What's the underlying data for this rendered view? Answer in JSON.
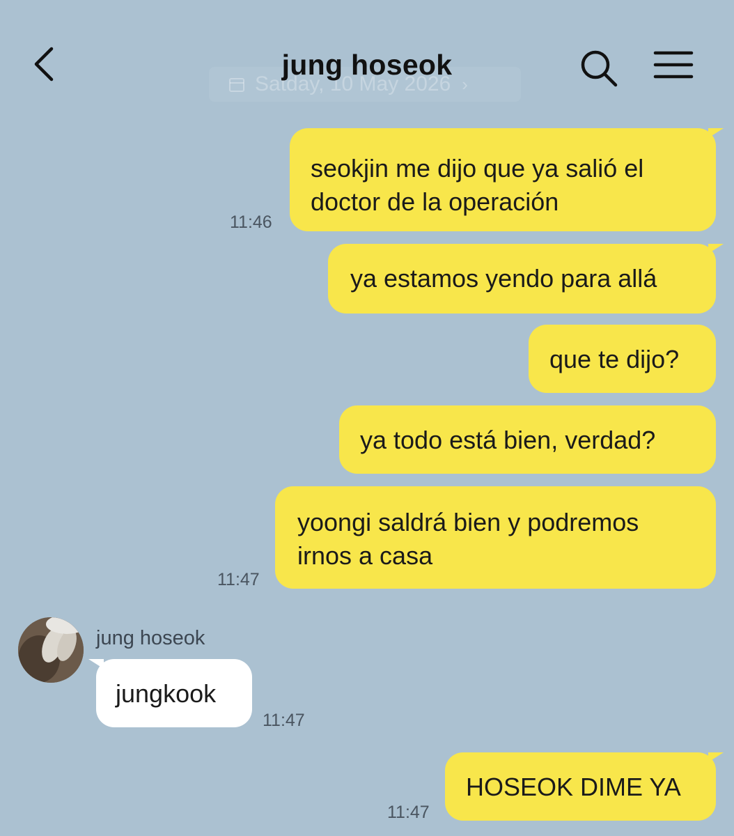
{
  "header": {
    "title": "jung hoseok",
    "date_overlay": "Satday, 10 May 2026"
  },
  "messages": [
    {
      "text": "seokjin me dijo que ya salió el\ndoctor de la operación",
      "time": "11:46"
    },
    {
      "text": "ya estamos yendo para allá"
    },
    {
      "text": "que te dijo?"
    },
    {
      "text": "ya todo está bien, verdad?"
    },
    {
      "text": "yoongi saldrá bien y podremos\nirnos a casa",
      "time": "11:47"
    },
    {
      "sender": "jung hoseok",
      "text": "jungkook",
      "time": "11:47"
    },
    {
      "text": "HOSEOK DIME YA",
      "time": "11:47"
    }
  ],
  "colors": {
    "background": "#abc1d1",
    "outgoing_bubble": "#f8e64b",
    "incoming_bubble": "#ffffff"
  },
  "icons": [
    "back-icon",
    "search-icon",
    "menu-icon",
    "calendar-icon",
    "chevron-right-icon"
  ]
}
